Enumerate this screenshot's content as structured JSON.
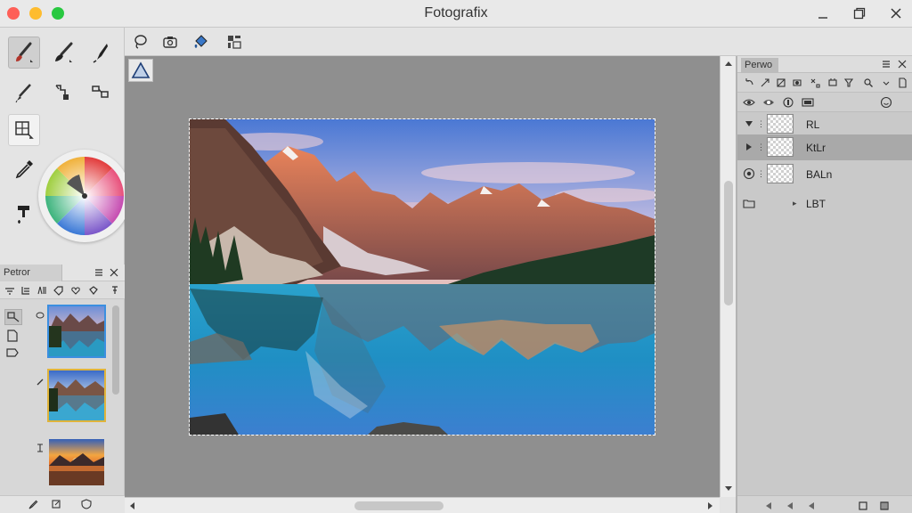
{
  "window": {
    "title": "Fotografix"
  },
  "colors": {
    "accent_active_thumb": "#3b8fe0",
    "accent_hover_thumb": "#e0b43b",
    "close": "#fe5f57",
    "minimize": "#febc2e",
    "zoom": "#28c840"
  },
  "toolbar": {
    "icons": [
      "lasso-icon",
      "camera-icon",
      "bucket-icon",
      "grid-select-icon"
    ]
  },
  "tools": {
    "items": [
      "brush-tool",
      "paint-brush-tool",
      "pen-tool",
      "pencil-tool",
      "clone-tool",
      "move-tool",
      "crop-tool",
      "eyedropper-tool",
      "stamp-tool"
    ],
    "active": "brush-tool"
  },
  "left_panel": {
    "tab_label": "Petror",
    "thumbnails": [
      "mountain-lake",
      "mountain-lake-alt",
      "sunset-landscape"
    ],
    "selected": 0
  },
  "layers_panel": {
    "tab_label": "Perwo",
    "layers": [
      {
        "name": "RL",
        "visible": true,
        "expanded": true
      },
      {
        "name": "KtLr",
        "visible": false,
        "expanded": false,
        "active": true
      },
      {
        "name": "BALn",
        "visible": true,
        "expanded": false
      },
      {
        "name": "LBT",
        "visible": false,
        "is_group": true
      }
    ]
  }
}
